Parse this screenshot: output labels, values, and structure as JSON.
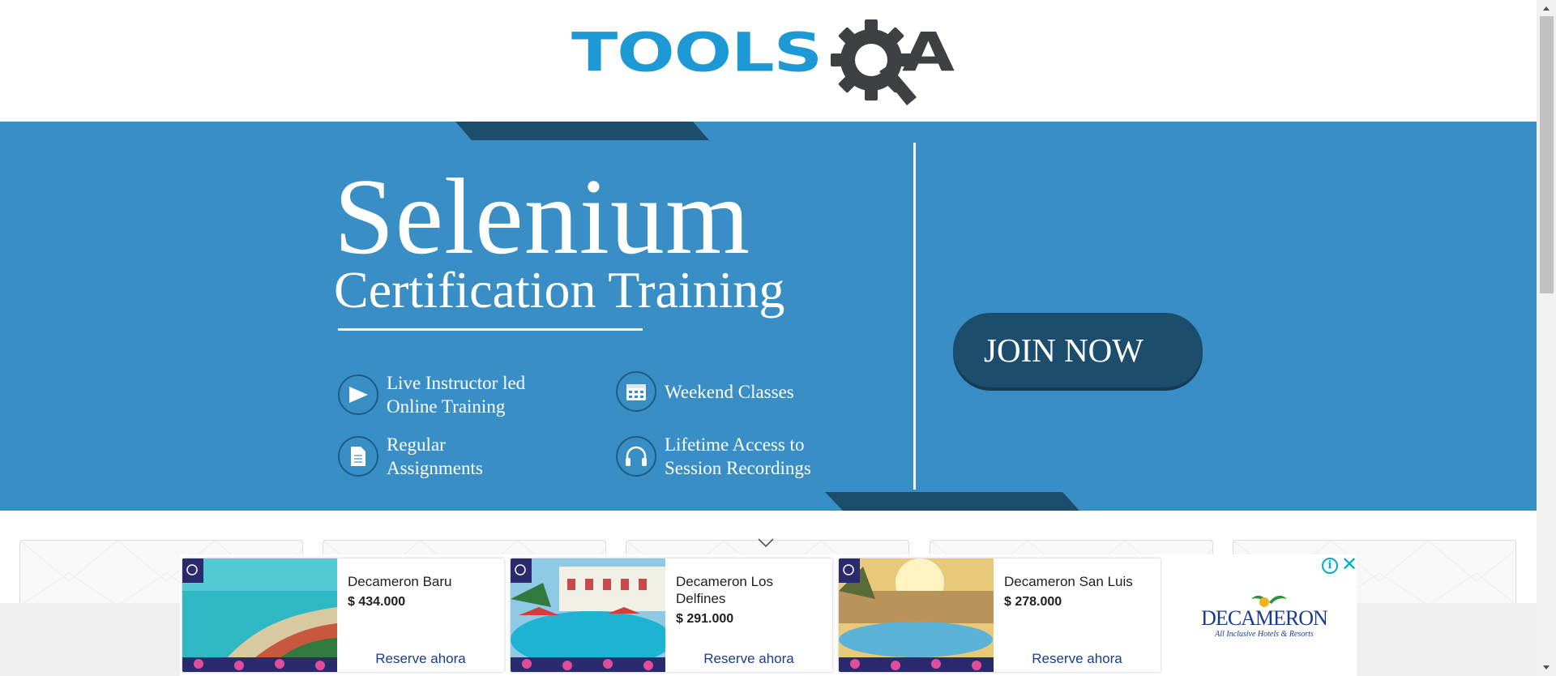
{
  "header": {
    "logo_text": "TOOLS",
    "logo_suffix": "A"
  },
  "banner": {
    "title": "Selenium",
    "subtitle": "Certification Training",
    "features": [
      {
        "icon": "play-icon",
        "text": "Live Instructor led\nOnline Training"
      },
      {
        "icon": "calendar-icon",
        "text": "Weekend Classes"
      },
      {
        "icon": "document-icon",
        "text": "Regular\nAssignments"
      },
      {
        "icon": "headphones-icon",
        "text": "Lifetime Access to\nSession Recordings"
      }
    ],
    "cta_label": "JOIN NOW"
  },
  "ad": {
    "items": [
      {
        "name": "Decameron Baru",
        "price": "$ 434.000",
        "cta": "Reserve ahora"
      },
      {
        "name": "Decameron Los Delfines",
        "price": "$ 291.000",
        "cta": "Reserve ahora"
      },
      {
        "name": "Decameron San Luis",
        "price": "$ 278.000",
        "cta": "Reserve ahora"
      }
    ],
    "brand_name": "DECAMERON",
    "brand_tagline": "All Inclusive Hotels & Resorts",
    "info_label": "i",
    "close_label": "✕"
  },
  "colors": {
    "banner_blue": "#3a8ec6",
    "dark_navy": "#1c4d6d",
    "logo_blue": "#1d9ad6",
    "logo_gray": "#3f4043",
    "ad_accent": "#00aecd",
    "ad_link": "#1a3c8f"
  }
}
